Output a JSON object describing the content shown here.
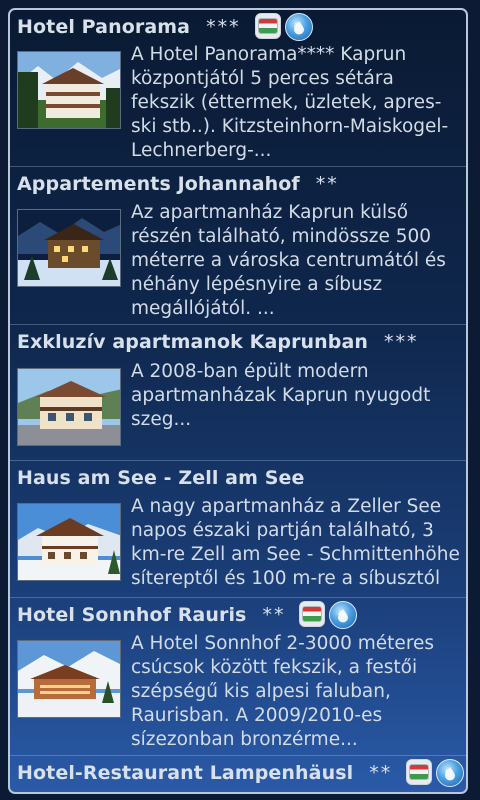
{
  "items": [
    {
      "title": "Hotel Panorama",
      "stars": "***",
      "badges": [
        "hu-flag-icon",
        "water-drop-icon"
      ],
      "desc": "A Hotel Panorama**** Kaprun központjától 5 perces sétára fekszik (éttermek, üzletek, apres-ski stb..). Kitzsteinhorn-Maiskogel-Lechnerberg-..."
    },
    {
      "title": "Appartements Johannahof",
      "stars": "**",
      "badges": [],
      "desc": "Az apartmanház Kaprun külső részén található, mindössze 500 méterre a városka centrumától és néhány lépésnyire a síbusz megállójától. ..."
    },
    {
      "title": "Exkluzív apartmanok Kaprunban",
      "stars": "***",
      "badges": [],
      "desc": "A 2008-ban épült modern apartmanházak Kaprun nyugodt szeg..."
    },
    {
      "title": "Haus am See - Zell am See",
      "stars": "",
      "badges": [],
      "desc": "A nagy apartmanház a Zeller See napos északi partján található, 3 km-re Zell am See - Schmittenhöhe sítereptől és 100 m-re a síbusztól"
    },
    {
      "title": "Hotel Sonnhof Rauris",
      "stars": "**",
      "badges": [
        "hu-flag-icon",
        "water-drop-icon"
      ],
      "desc": "A Hotel Sonnhof 2-3000 méteres csúcsok között fekszik, a festői szépségű kis alpesi faluban, Raurisban. A 2009/2010-es sízezonban bronzérme..."
    },
    {
      "title": "Hotel-Restaurant Lampenhäusl",
      "stars": "**",
      "badges": [
        "hu-flag-icon",
        "water-drop-icon"
      ],
      "desc": ""
    }
  ]
}
